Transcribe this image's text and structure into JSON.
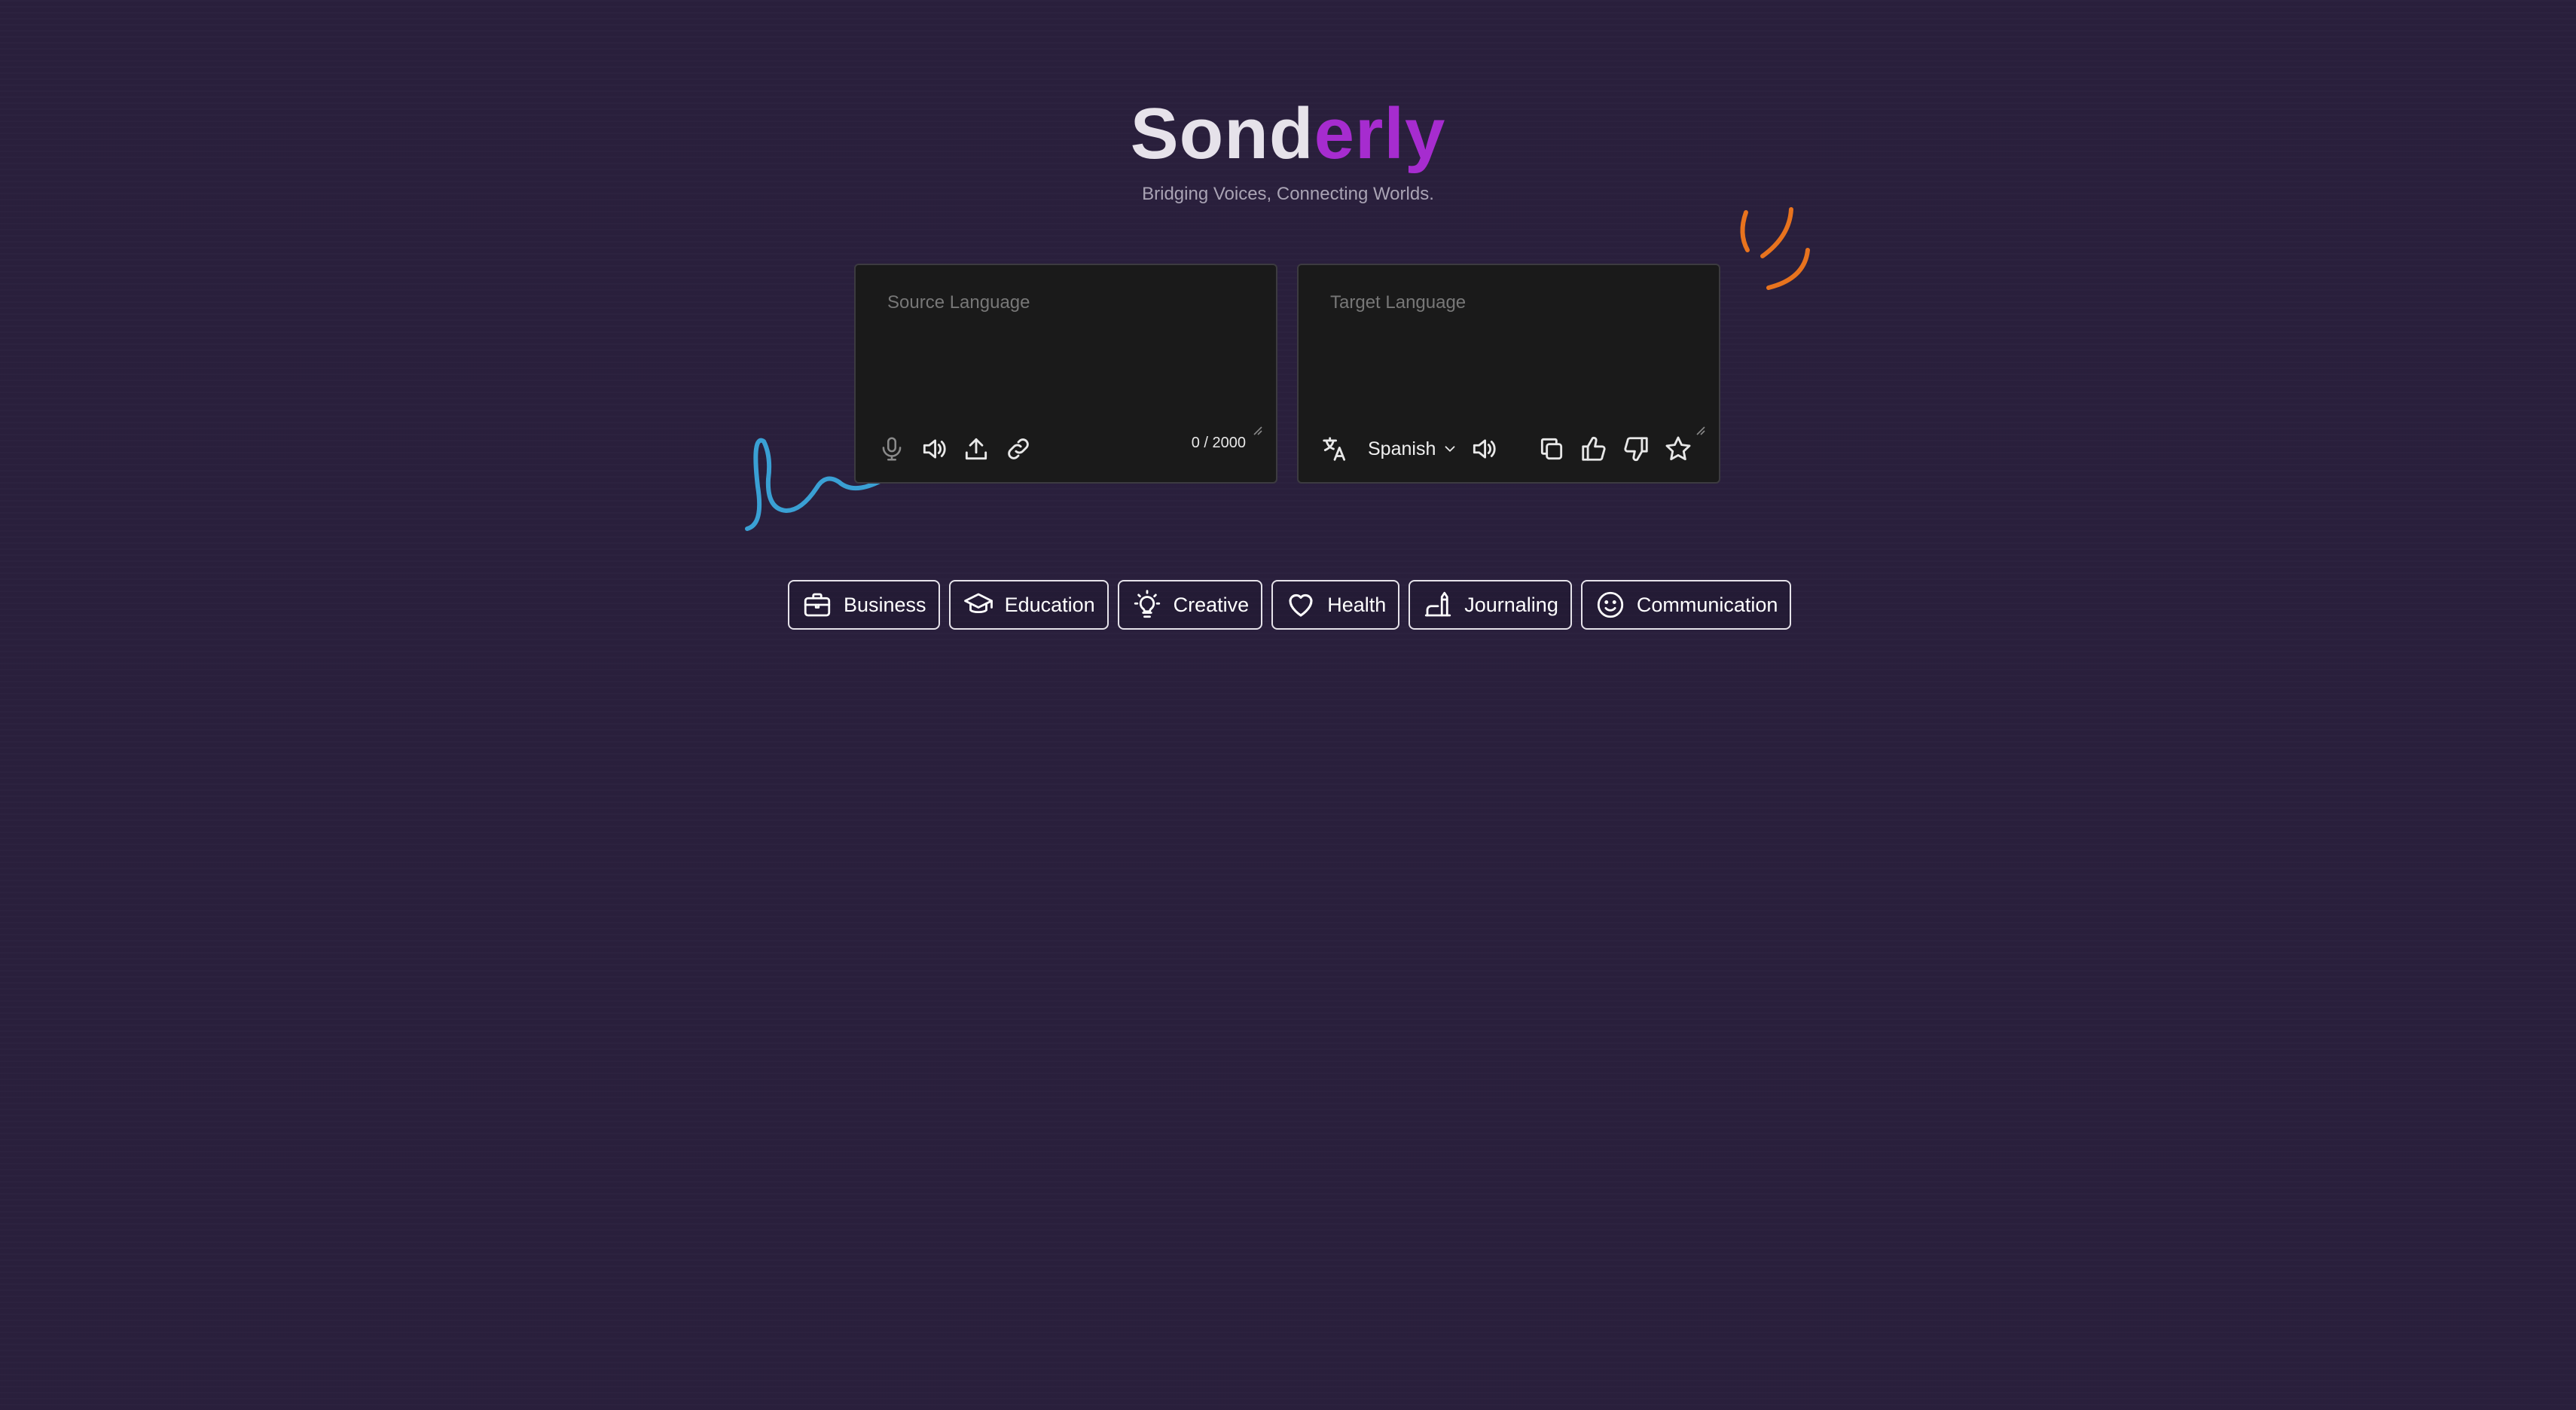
{
  "brand": {
    "name_part1": "Sond",
    "name_part2": "erly",
    "tagline": "Bridging Voices, Connecting Worlds."
  },
  "source_panel": {
    "placeholder": "Source Language",
    "counter": "0 / 2000",
    "icons": [
      "microphone-icon",
      "speaker-icon",
      "upload-icon",
      "link-icon"
    ]
  },
  "target_panel": {
    "placeholder": "Target Language",
    "language": "Spanish",
    "icons": [
      "translate-icon",
      "chevron-down-icon",
      "speaker-icon",
      "copy-icon",
      "thumbs-up-icon",
      "thumbs-down-icon",
      "star-icon"
    ]
  },
  "categories": [
    {
      "label": "Business",
      "icon": "briefcase-icon"
    },
    {
      "label": "Education",
      "icon": "graduation-cap-icon"
    },
    {
      "label": "Creative",
      "icon": "lightbulb-icon"
    },
    {
      "label": "Health",
      "icon": "heart-icon"
    },
    {
      "label": "Journaling",
      "icon": "pen-icon"
    },
    {
      "label": "Communication",
      "icon": "smile-icon"
    }
  ],
  "colors": {
    "background": "#2a1f3d",
    "accent": "#a62ccf",
    "panel": "#1a1a1a",
    "decoration_orange": "#e8731e",
    "decoration_blue": "#3aa0d4"
  }
}
